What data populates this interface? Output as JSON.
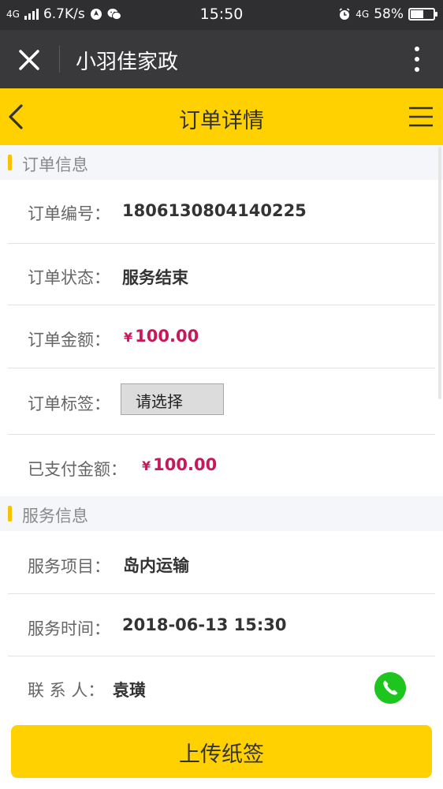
{
  "status_bar": {
    "network": "4G",
    "speed": "6.7K/s",
    "time": "15:50",
    "network_right": "4G",
    "battery": "58%",
    "battery_level": 0.58
  },
  "wechat_bar": {
    "title": "小羽佳家政"
  },
  "header": {
    "title": "订单详情"
  },
  "order_section": {
    "heading": "订单信息",
    "rows": [
      {
        "label": "订单编号：",
        "value": "1806130804140225"
      },
      {
        "label": "订单状态：",
        "value": "服务结束"
      },
      {
        "label": "订单金额：",
        "currency": "¥",
        "value": "100.00"
      },
      {
        "label": "订单标签：",
        "select_value": "请选择"
      },
      {
        "label": "已支付金额：",
        "currency": "¥",
        "value": "100.00"
      }
    ]
  },
  "service_section": {
    "heading": "服务信息",
    "rows": [
      {
        "label": "服务项目：",
        "value": "岛内运输"
      },
      {
        "label": "服务时间：",
        "value": "2018-06-13 15:30"
      },
      {
        "label": "联 系 人：",
        "value": "袁璜"
      }
    ]
  },
  "footer": {
    "upload_label": "上传纸签"
  },
  "colors": {
    "accent": "#ffd100",
    "price": "#c8175a",
    "phone": "#1ec51e",
    "title_bar": "#39393b"
  },
  "icons": {
    "close": "close-icon",
    "more": "more-vertical-icon",
    "back": "chevron-left-icon",
    "menu": "menu-icon",
    "phone": "phone-icon",
    "alarm": "alarm-icon",
    "battery": "battery-icon",
    "signal": "signal-icon",
    "wechat": "wechat-icon"
  }
}
